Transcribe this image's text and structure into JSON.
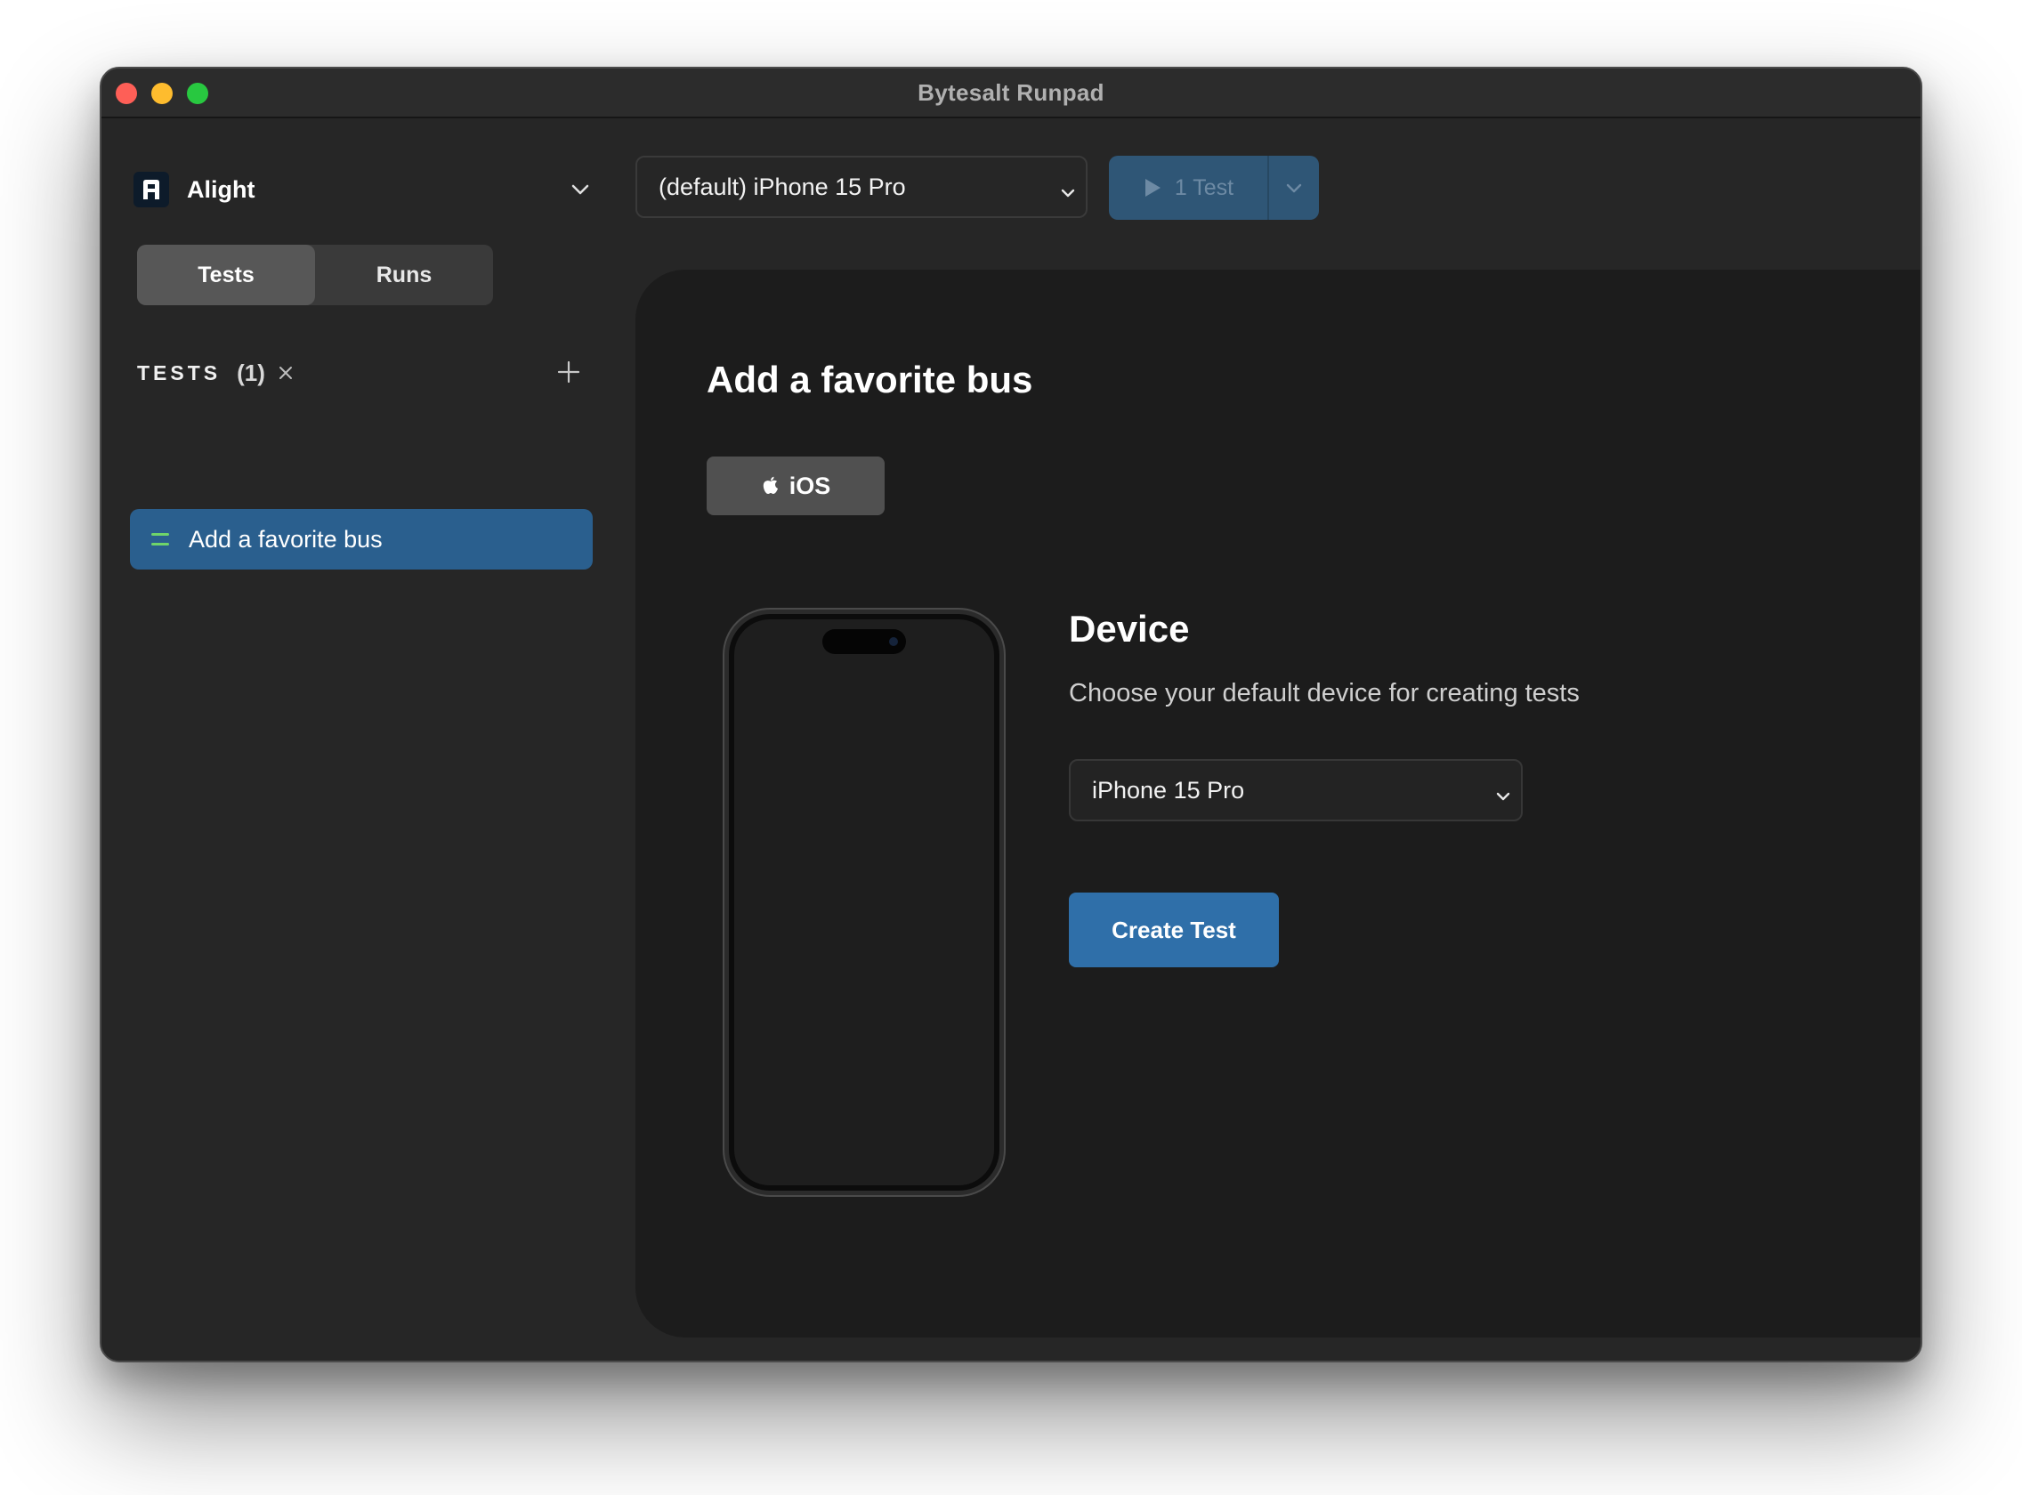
{
  "window": {
    "title": "Bytesalt Runpad"
  },
  "sidebar": {
    "workspace": {
      "name": "Alight",
      "icon": "workspace-logo-icon"
    },
    "tabs": [
      {
        "label": "Tests",
        "active": true
      },
      {
        "label": "Runs",
        "active": false
      }
    ],
    "tests_section": {
      "title": "TESTS",
      "count": "(1)"
    },
    "items": [
      {
        "label": "Add a favorite bus",
        "selected": true
      }
    ]
  },
  "toolbar": {
    "device_select": "(default) iPhone 15 Pro",
    "run_button_label": "1 Test"
  },
  "main": {
    "title": "Add a favorite bus",
    "platform_chip": "iOS",
    "device_heading": "Device",
    "device_description": "Choose your default device for creating tests",
    "device_dropdown": "iPhone 15 Pro",
    "create_button": "Create Test"
  },
  "colors": {
    "accent": "#2f6fa9",
    "selected_item": "#2a5f8e",
    "background": "#262626",
    "panel": "#1c1c1c"
  }
}
